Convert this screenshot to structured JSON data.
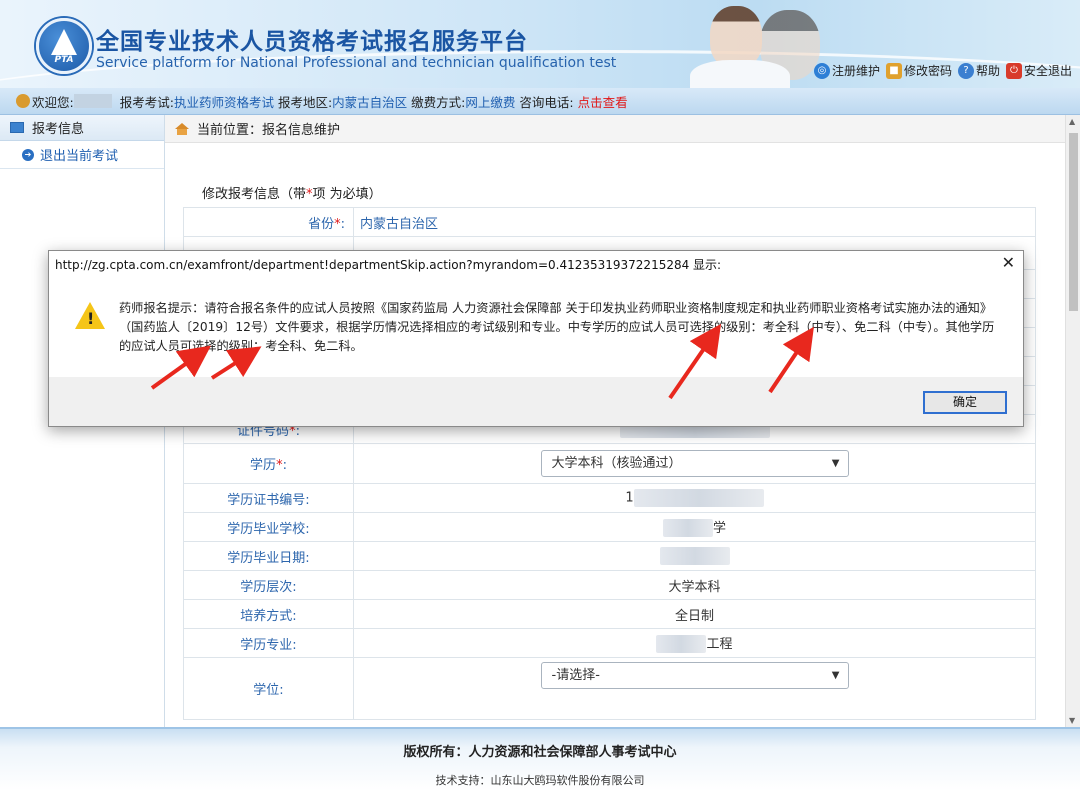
{
  "header": {
    "logo_text": "PTA",
    "title": "全国专业技术人员资格考试报名服务平台",
    "subtitle": "Service platform for National Professional and technician qualification test",
    "links": [
      {
        "label": "注册维护",
        "icon": "globe-icon"
      },
      {
        "label": "修改密码",
        "icon": "lock-icon"
      },
      {
        "label": "帮助",
        "icon": "help-icon"
      },
      {
        "label": "安全退出",
        "icon": "power-icon"
      }
    ]
  },
  "infobar": {
    "welcome": "欢迎您:",
    "exam_label": "报考考试:",
    "exam_value": "执业药师资格考试",
    "region_label": "报考地区:",
    "region_value": "内蒙古自治区",
    "pay_label": "缴费方式:",
    "pay_value": "网上缴费",
    "phone_label": "咨询电话:",
    "phone_value": "点击查看"
  },
  "sidebar": {
    "heading": "报考信息",
    "items": [
      {
        "label": "退出当前考试"
      }
    ]
  },
  "breadcrumb": "当前位置：报名信息维护",
  "form": {
    "title_prefix": "修改报考信息（带",
    "title_star": "*",
    "title_suffix": "项 为必填）",
    "rows": [
      {
        "label": "省份",
        "required": true,
        "value": "内蒙古自治区"
      },
      {
        "label": "证件号码",
        "required": true
      },
      {
        "label": "学历",
        "required": true,
        "value": "大学本科（核验通过）"
      },
      {
        "label": "学历证书编号:",
        "value_prefix": "1"
      },
      {
        "label": "学历毕业学校:",
        "value_suffix": "学"
      },
      {
        "label": "学历毕业日期:"
      },
      {
        "label": "学历层次:",
        "value": "大学本科"
      },
      {
        "label": "培养方式:",
        "value": "全日制"
      },
      {
        "label": "学历专业:",
        "value_suffix": "工程"
      },
      {
        "label": "学位:",
        "value": "-请选择-"
      }
    ]
  },
  "dialog": {
    "title": "http://zg.cpta.com.cn/examfront/department!departmentSkip.action?myrandom=0.41235319372215284 显示:",
    "message": "药师报名提示：请符合报名条件的应试人员按照《国家药监局 人力资源社会保障部 关于印发执业药师职业资格制度规定和执业药师职业资格考试实施办法的通知》（国药监人〔2019〕12号）文件要求，根据学历情况选择相应的考试级别和专业。中专学历的应试人员可选择的级别：考全科（中专）、免二科（中专）。其他学历的应试人员可选择的级别：考全科、免二科。",
    "ok_label": "确定"
  },
  "footer": {
    "copyright": "版权所有：人力资源和社会保障部人事考试中心",
    "tech": "技术支持：山东山大鸥玛软件股份有限公司"
  },
  "colors": {
    "accent_blue": "#1f5fb0",
    "alert_red": "#e01818",
    "arrow_red": "#e8281e"
  }
}
